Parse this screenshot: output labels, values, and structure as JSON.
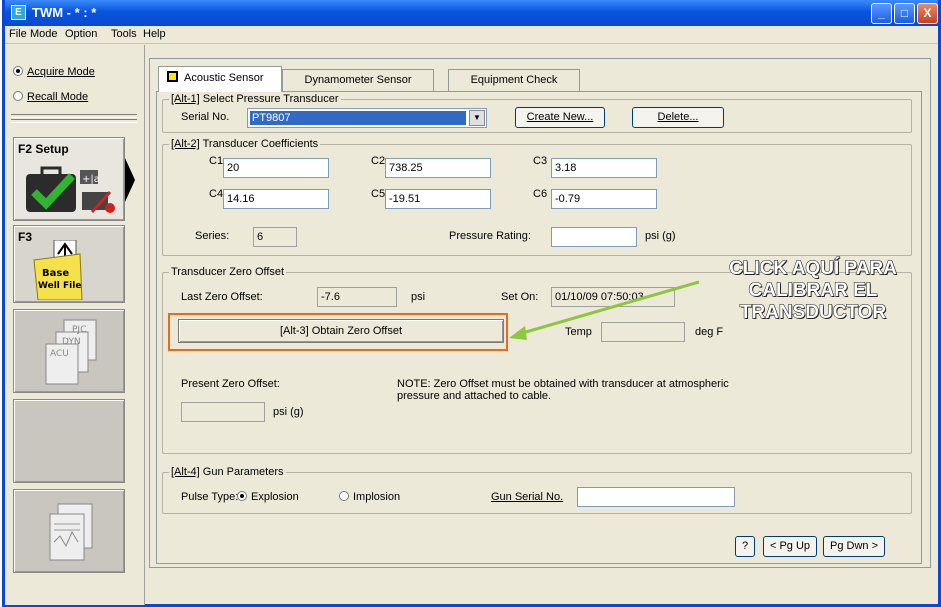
{
  "window": {
    "title": "TWM  -  * : *",
    "icon_letter": "E",
    "min": "_",
    "max": "□",
    "close": "X"
  },
  "menu": [
    "File",
    "Mode",
    "Option",
    "Tools",
    "Help"
  ],
  "sidebar": {
    "acquire_mode": "Acquire Mode",
    "recall_mode": "Recall Mode",
    "setup_label": "F2 Setup",
    "f3_label": "F3",
    "base_well_file": "Base Well File",
    "pjc_labels": [
      "PJC",
      "DYN",
      "ACU"
    ]
  },
  "tabs": [
    "Acoustic Sensor",
    "Dynamometer Sensor",
    "Equipment Check"
  ],
  "pressure_transducer": {
    "legend_prefix": "[Alt-1]",
    "legend": "Select Pressure Transducer",
    "serial_label": "Serial No.",
    "serial_value": "PT9807",
    "create_new": "Create New...",
    "delete": "Delete..."
  },
  "coefficients": {
    "legend_prefix": "[Alt-2]",
    "legend": "Transducer Coefficients",
    "c1_label": "C1",
    "c1": "20",
    "c2_label": "C2",
    "c2": "738.25",
    "c3_label": "C3",
    "c3": "3.18",
    "c4_label": "C4",
    "c4": "14.16",
    "c5_label": "C5",
    "c5": "-19.51",
    "c6_label": "C6",
    "c6": "-0.79",
    "series_label": "Series:",
    "series": "6",
    "pressure_rating_label": "Pressure Rating:",
    "pressure_rating": "",
    "pressure_unit": "psi (g)"
  },
  "zero_offset": {
    "legend": "Transducer Zero Offset",
    "last_zero_label": "Last Zero Offset:",
    "last_zero": "-7.6",
    "last_zero_unit": "psi",
    "set_on_label": "Set On:",
    "set_on": "01/10/09 07:50:03",
    "obtain_button": "[Alt-3]  Obtain Zero Offset",
    "temp_label": "Temp",
    "temp": "",
    "temp_unit": "deg F",
    "present_label": "Present Zero Offset:",
    "present": "",
    "present_unit": "psi (g)",
    "note": "NOTE:  Zero Offset must be obtained with transducer at atmospheric pressure and attached to cable."
  },
  "gun": {
    "legend_prefix": "[Alt-4]",
    "legend": "Gun Parameters",
    "pulse_label": "Pulse Type:",
    "explosion": "Explosion",
    "implosion": "Implosion",
    "gun_serial_label": "Gun Serial No.",
    "gun_serial": ""
  },
  "footer": {
    "help": "?",
    "pgup": "< Pg Up",
    "pgdn": "Pg Dwn >"
  },
  "callout": [
    "CLICK AQUÍ PARA",
    "CALIBRAR EL",
    "TRANSDUCTOR"
  ],
  "colors": {
    "highlight": "#e86b1b",
    "arrow": "#8dc63f",
    "titlebar": "#0a49d0"
  }
}
